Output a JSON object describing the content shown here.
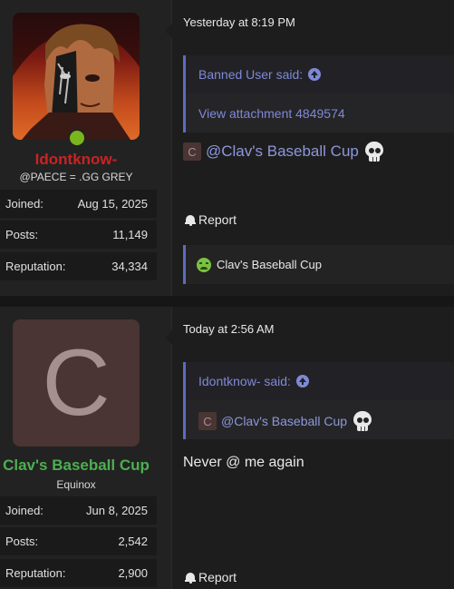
{
  "post1": {
    "user": {
      "name": "Idontknow-",
      "name_color": "#cc2222",
      "title": "@PAECE = .GG GREY",
      "online": true,
      "stats": [
        {
          "label": "Joined:",
          "value": "Aug 15, 2025"
        },
        {
          "label": "Posts:",
          "value": "11,149"
        },
        {
          "label": "Reputation:",
          "value": "34,334"
        }
      ]
    },
    "date": "Yesterday at 8:19 PM",
    "quote": {
      "author": "Banned User said:",
      "body": "View attachment 4849574"
    },
    "mention": {
      "avatar_letter": "C",
      "text": "@Clav's Baseball Cup",
      "emoji": "skull-icon"
    },
    "report_label": "Report",
    "reaction": {
      "emoji": "sick-face-icon",
      "user": "Clav's Baseball Cup"
    }
  },
  "post2": {
    "user": {
      "avatar_letter": "C",
      "name": "Clav's Baseball Cup",
      "name_color": "#4caf50",
      "title": "Equinox",
      "stats": [
        {
          "label": "Joined:",
          "value": "Jun 8, 2025"
        },
        {
          "label": "Posts:",
          "value": "2,542"
        },
        {
          "label": "Reputation:",
          "value": "2,900"
        }
      ]
    },
    "date": "Today at 2:56 AM",
    "quote": {
      "author": "Idontknow- said:",
      "mention": {
        "avatar_letter": "C",
        "text": "@Clav's Baseball Cup",
        "emoji": "skull-icon"
      }
    },
    "message": "Never @ me again",
    "report_label": "Report"
  }
}
